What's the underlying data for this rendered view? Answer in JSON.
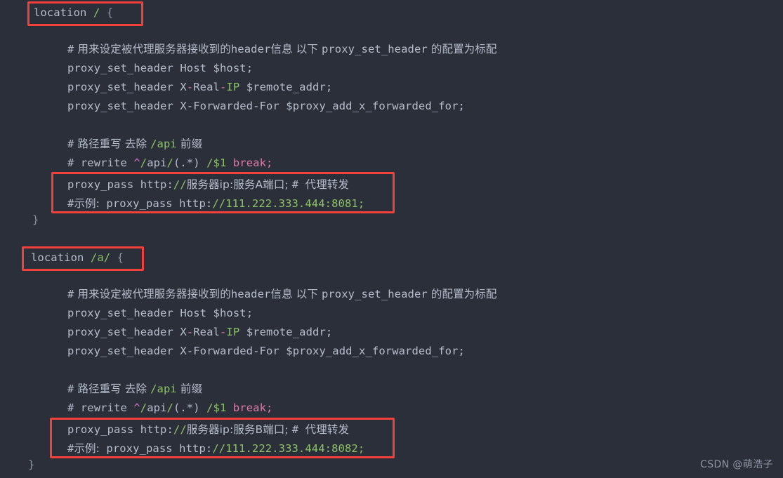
{
  "editor": {
    "background_color": "#2b2f3a",
    "default_text_color": "#b6bdcc",
    "accent_green": "#8cc265",
    "accent_pink": "#e07aa8",
    "highlight_border_color": "#f4403a"
  },
  "blocks": [
    {
      "header": {
        "keyword": "location",
        "path": "/",
        "brace": "{"
      },
      "comment_header": {
        "hash": "#",
        "text_cjk_1": " 用来设定被代理服务器接收到的",
        "code_1": "header",
        "text_cjk_2": "信息 以下 ",
        "code_2": "proxy_set_header",
        "text_cjk_3": " 的配置为标配"
      },
      "set_headers": [
        {
          "directive": "proxy_set_header",
          "name": "Host",
          "value": "$host;"
        },
        {
          "directive": "proxy_set_header",
          "name_a": "X",
          "dash1": "-",
          "name_b": "Real",
          "dash2": "-",
          "name_c": "IP",
          "value": "$remote_addr;"
        },
        {
          "directive": "proxy_set_header",
          "name": "X-Forwarded-For",
          "value": "$proxy_add_x_forwarded_for;"
        }
      ],
      "rewrite_comment": {
        "hash": "#",
        "text_1": " 路径重写 去除 ",
        "path": "/api",
        "text_2": " 前缀"
      },
      "rewrite_line": {
        "hash": "#",
        "keyword": " rewrite ",
        "caret": "^",
        "slash1": "/",
        "api": "api",
        "slash2": "/",
        "group": "(.*)",
        "space": " ",
        "slash3": "/",
        "capture": "$1",
        "break": " break",
        "semi": ";"
      },
      "proxy_pass": {
        "directive": "proxy_pass",
        "scheme": " http:",
        "slashes": "//",
        "target_cjk": "服务器ip:服务A端口",
        "semi": "; ",
        "trailing_hash": "# ",
        "trailing_cjk": "代理转发"
      },
      "example": {
        "hash": "#",
        "label_cjk": "示例:",
        "directive": " proxy_pass",
        "scheme": " http:",
        "slashes": "//",
        "host": "111.222.333.444:8081",
        "semi": ";"
      },
      "closing_brace": "}"
    },
    {
      "header": {
        "keyword": "location",
        "path": "/a/",
        "brace": "{"
      },
      "comment_header": {
        "hash": "#",
        "text_cjk_1": " 用来设定被代理服务器接收到的",
        "code_1": "header",
        "text_cjk_2": "信息 以下 ",
        "code_2": "proxy_set_header",
        "text_cjk_3": " 的配置为标配"
      },
      "set_headers": [
        {
          "directive": "proxy_set_header",
          "name": "Host",
          "value": "$host;"
        },
        {
          "directive": "proxy_set_header",
          "name_a": "X",
          "dash1": "-",
          "name_b": "Real",
          "dash2": "-",
          "name_c": "IP",
          "value": "$remote_addr;"
        },
        {
          "directive": "proxy_set_header",
          "name": "X-Forwarded-For",
          "value": "$proxy_add_x_forwarded_for;"
        }
      ],
      "rewrite_comment": {
        "hash": "#",
        "text_1": " 路径重写 去除 ",
        "path": "/api",
        "text_2": " 前缀"
      },
      "rewrite_line": {
        "hash": "#",
        "keyword": " rewrite ",
        "caret": "^",
        "slash1": "/",
        "api": "api",
        "slash2": "/",
        "group": "(.*)",
        "space": " ",
        "slash3": "/",
        "capture": "$1",
        "break": " break",
        "semi": ";"
      },
      "proxy_pass": {
        "directive": "proxy_pass",
        "scheme": " http:",
        "slashes": "//",
        "target_cjk": "服务器ip:服务B端口",
        "semi": "; ",
        "trailing_hash": "# ",
        "trailing_cjk": "代理转发"
      },
      "example": {
        "hash": "#",
        "label_cjk": "示例:",
        "directive": " proxy_pass",
        "scheme": " http:",
        "slashes": "//",
        "host": "111.222.333.444:8082",
        "semi": ";"
      },
      "closing_brace": "}"
    }
  ],
  "watermark": {
    "text": "CSDN @萌浩子"
  }
}
